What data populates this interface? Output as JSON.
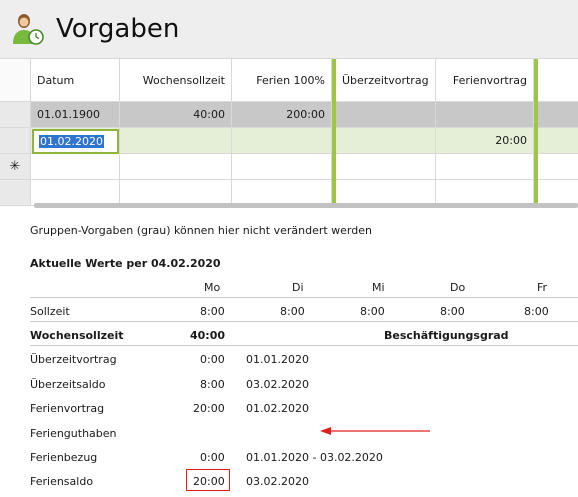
{
  "header": {
    "title": "Vorgaben",
    "icon": "user-clock-icon"
  },
  "grid": {
    "columns": [
      "Datum",
      "Wochensollzeit",
      "Ferien 100%",
      "Überzeitvortrag",
      "Ferienvortrag"
    ],
    "rows": [
      {
        "datum": "01.01.1900",
        "wochensollzeit": "40:00",
        "ferien": "200:00",
        "ueberzeitvortrag": "",
        "ferienvortrag": ""
      },
      {
        "datum": "01.02.2020",
        "wochensollzeit": "",
        "ferien": "",
        "ueberzeitvortrag": "",
        "ferienvortrag": "20:00"
      }
    ],
    "new_row_marker": "✳"
  },
  "info_text": "Gruppen-Vorgaben (grau) können hier nicht verändert werden",
  "current": {
    "heading": "Aktuelle Werte per 04.02.2020",
    "days": [
      "Mo",
      "Di",
      "Mi",
      "Do",
      "Fr"
    ],
    "sollzeit_label": "Sollzeit",
    "sollzeit_values": [
      "8:00",
      "8:00",
      "8:00",
      "8:00",
      "8:00"
    ],
    "wochensollzeit_label": "Wochensollzeit",
    "wochensollzeit_value": "40:00",
    "beschaeftigungsgrad_label": "Beschäftigungsgrad",
    "rows": [
      {
        "label": "Überzeitvortrag",
        "value": "0:00",
        "date": "01.01.2020"
      },
      {
        "label": "Überzeitsaldo",
        "value": "8:00",
        "date": "03.02.2020"
      },
      {
        "label": "Ferienvortrag",
        "value": "20:00",
        "date": "01.02.2020"
      },
      {
        "label": "Ferienguthaben",
        "value": "",
        "date": ""
      },
      {
        "label": "Ferienbezug",
        "value": "0:00",
        "date": "01.01.2020 - 03.02.2020"
      },
      {
        "label": "Feriensaldo",
        "value": "20:00",
        "date": "03.02.2020"
      }
    ]
  },
  "annotation_color": "#e02020"
}
